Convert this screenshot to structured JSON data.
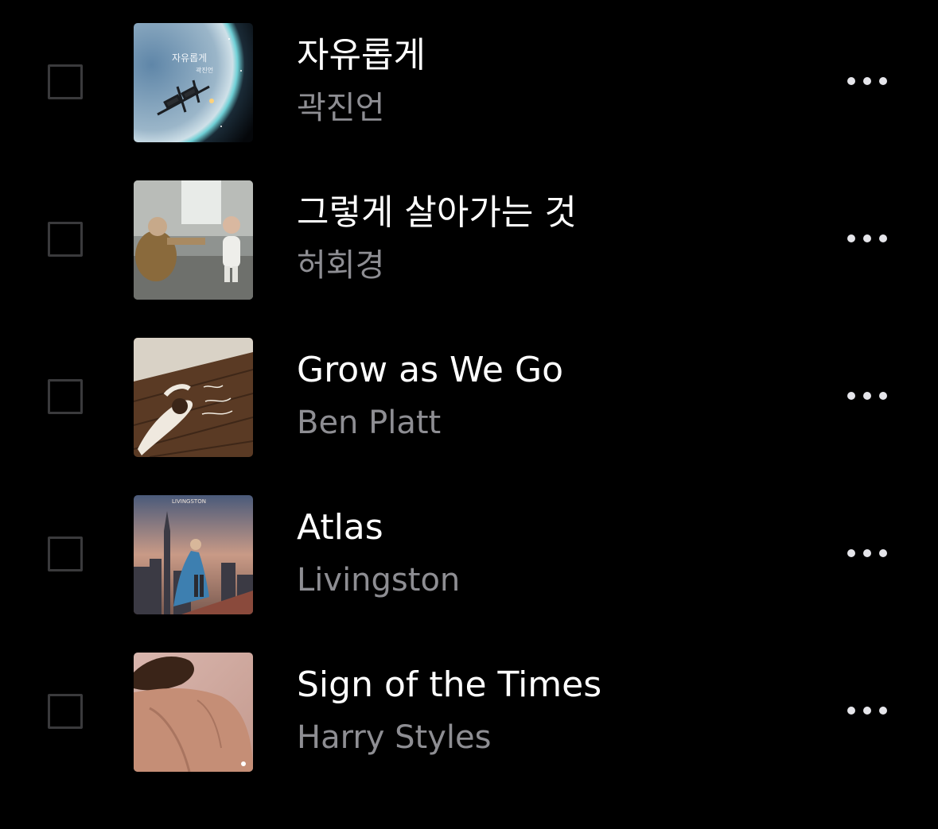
{
  "colors": {
    "background": "#000000",
    "title_text": "#ffffff",
    "artist_text": "#8e8e93",
    "checkbox_border": "#3a3a3c",
    "more_dots": "#e5e5ea"
  },
  "tracks": [
    {
      "title": "자유롭게",
      "artist": "곽진언",
      "selected": false,
      "artwork_icon": "album-art-earth-space-station",
      "artwork_text": [
        "자유롭게",
        "곽진언"
      ],
      "more_icon": "ellipsis-icon"
    },
    {
      "title": "그렇게 살아가는 것",
      "artist": "허회경",
      "selected": false,
      "artwork_icon": "album-art-grandfather-child-photo",
      "more_icon": "ellipsis-icon"
    },
    {
      "title": "Grow as We Go",
      "artist": "Ben Platt",
      "selected": false,
      "artwork_icon": "album-art-man-lying-on-floor",
      "more_icon": "ellipsis-icon"
    },
    {
      "title": "Atlas",
      "artist": "Livingston",
      "selected": false,
      "artwork_icon": "album-art-city-skyline-caped-figure",
      "artwork_text": [
        "LIVINGSTON"
      ],
      "more_icon": "ellipsis-icon"
    },
    {
      "title": "Sign of the Times",
      "artist": "Harry Styles",
      "selected": false,
      "artwork_icon": "album-art-bare-back-portrait",
      "more_icon": "ellipsis-icon"
    }
  ]
}
